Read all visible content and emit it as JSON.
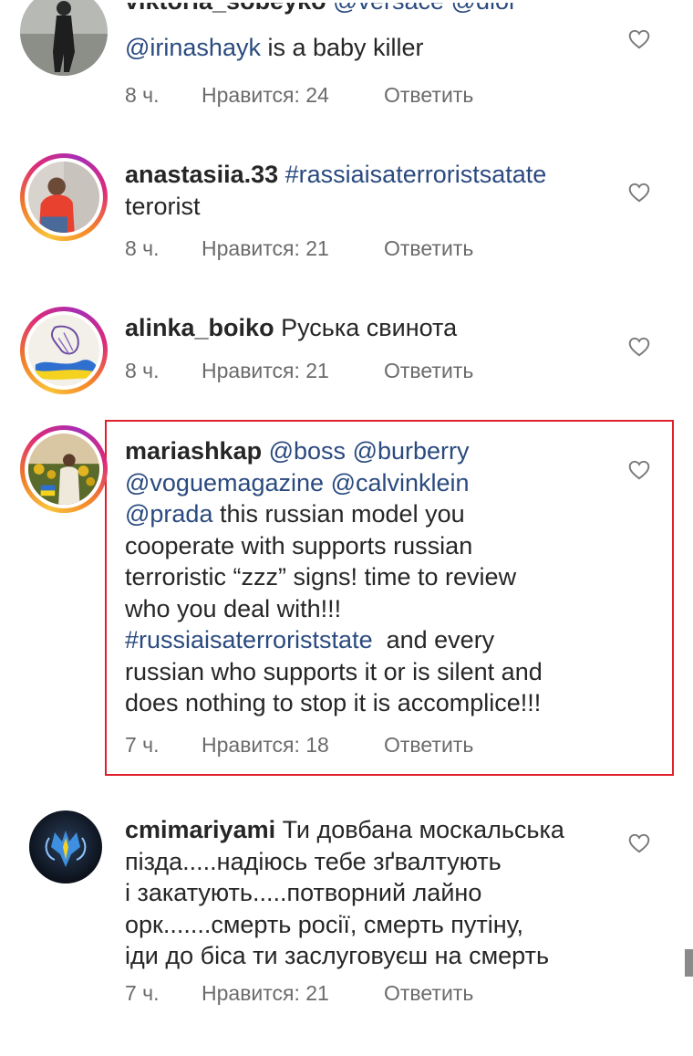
{
  "comments": [
    {
      "username": "viktoria_sobeyko",
      "cut_top": "@versace @dior",
      "line_mention": "@irinashayk",
      "line_rest": " is a baby killer",
      "time": "8 ч.",
      "likes": "Нравится: 24",
      "reply": "Ответить"
    },
    {
      "username": "anastasiia.33",
      "hashtag": "#rassiaisaterroristsatate",
      "rest": "terorist",
      "time": "8 ч.",
      "likes": "Нравится: 21",
      "reply": "Ответить"
    },
    {
      "username": "alinka_boiko",
      "rest": "Руська свинота",
      "time": "8 ч.",
      "likes": "Нравится: 21",
      "reply": "Ответить"
    },
    {
      "username": "mariashkap",
      "mention1": "@boss",
      "mention2": "@burberry",
      "mention3": "@voguemagazine",
      "mention4": "@calvinklein",
      "mention5": "@prada",
      "text1": " this russian model you",
      "text2": "cooperate with supports russian",
      "text3": "terroristic “zzz” signs! time to review",
      "text4": "who you deal with!!!",
      "hashtag": "#russiaisaterroriststate",
      "text5": "  and every",
      "text6": "russian who supports it or is silent and",
      "text7": "does nothing to stop it is accomplice!!!",
      "time": "7 ч.",
      "likes": "Нравится: 18",
      "reply": "Ответить"
    },
    {
      "username": "cmimariyami",
      "line1": " Ти довбана москальська",
      "line2": "пізда.....надіюсь тебе зґвалтують",
      "line3": "і закатують.....потворний лайно",
      "line4": "орк.......смерть росії, смерть путіну,",
      "line5": "іди до біса ти заслуговуєш на смерть",
      "time": "7 ч.",
      "likes": "Нравится: 21",
      "reply": "Ответить"
    }
  ],
  "colors": {
    "mention": "#2a4a7f",
    "highlight_border": "#e0202a",
    "meta": "#6b6b6b"
  },
  "icons": [
    "heart-icon",
    "avatar"
  ]
}
